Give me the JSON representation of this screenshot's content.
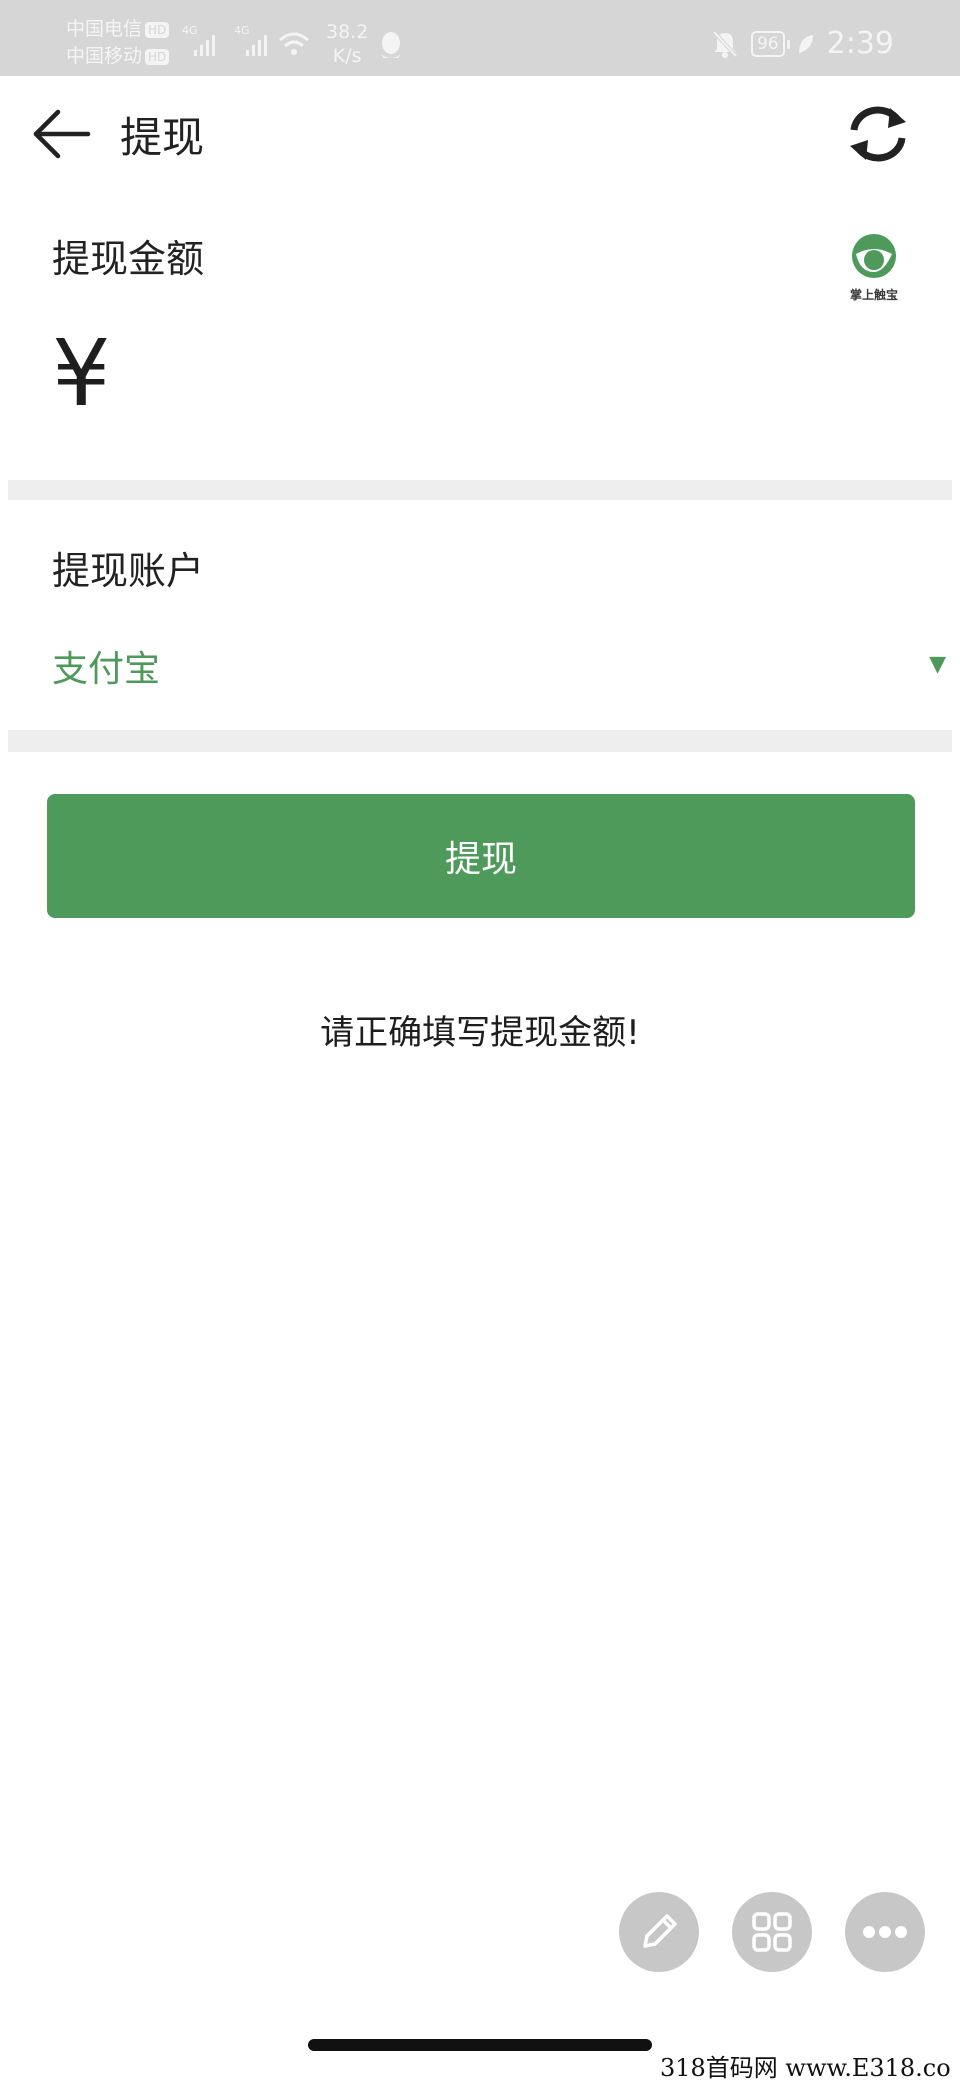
{
  "status_bar": {
    "carrier1": "中国电信",
    "carrier2": "中国移动",
    "hd": "HD",
    "net1": "4G",
    "net2": "4G",
    "speed_value": "38.2",
    "speed_unit": "K/s",
    "battery": "96",
    "time": "2:39",
    "icons": [
      "signal-icon",
      "wifi-icon",
      "qq-icon",
      "bell-muted-icon",
      "battery-icon",
      "leaf-icon"
    ]
  },
  "nav": {
    "title": "提现",
    "back_icon": "arrow-left-icon",
    "refresh_icon": "refresh-icon"
  },
  "amount_section": {
    "label": "提现金额",
    "currency": "¥",
    "input_value": "",
    "logo_text": "掌上触宝"
  },
  "account_section": {
    "label": "提现账户",
    "selected": "支付宝",
    "caret": "▼"
  },
  "submit": {
    "label": "提现"
  },
  "hint": {
    "text": "请正确填写提现金额!"
  },
  "floating_buttons": [
    "pencil-icon",
    "grid-icon",
    "more-icon"
  ],
  "watermark": "318首码网 www.E318.co",
  "colors": {
    "accent": "#4e9a5a",
    "status_bar_bg": "#d6d6d6",
    "section_gap": "#eeeeee",
    "fab_bg": "#c7c7c7"
  }
}
